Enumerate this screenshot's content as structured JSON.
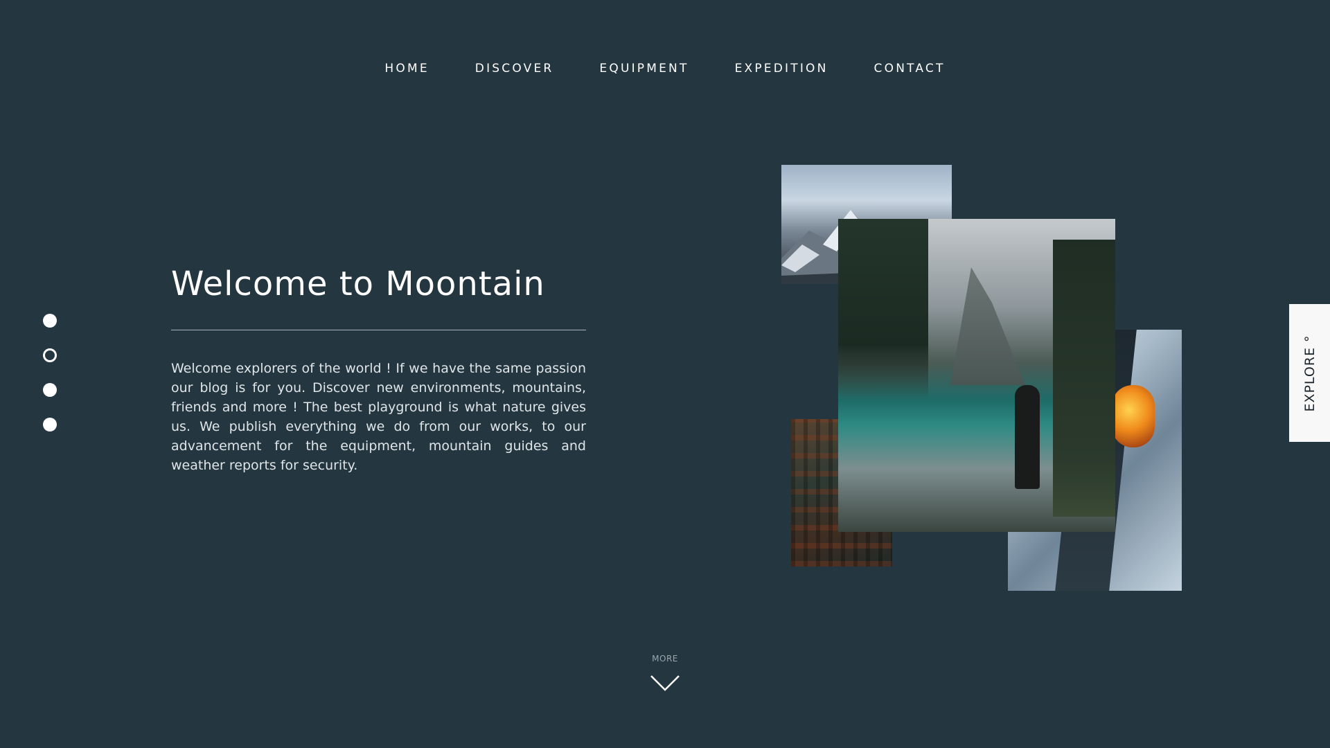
{
  "nav": {
    "items": [
      {
        "label": "HOME"
      },
      {
        "label": "DISCOVER"
      },
      {
        "label": "EQUIPMENT"
      },
      {
        "label": "EXPEDITION"
      },
      {
        "label": "CONTACT"
      }
    ]
  },
  "slider": {
    "dots": [
      "filled",
      "outline",
      "filled",
      "filled"
    ]
  },
  "hero": {
    "title": "Welcome to Moontain",
    "body": "Welcome explorers of the world ! If we have the same passion our blog is for you. Discover new environments, mountains, friends and more ! The best playground is what nature gives us. We publish everything we do from our works, to our advancement for the equipment, mountain guides and weather reports for security."
  },
  "explore": {
    "label": "EXPLORE °"
  },
  "more": {
    "label": "MORE",
    "icon": "chevron-down-icon"
  },
  "colors": {
    "background": "#243640",
    "text": "#ffffff",
    "body_text": "#dfe5e8",
    "explore_tab": "#f8f8f8"
  }
}
